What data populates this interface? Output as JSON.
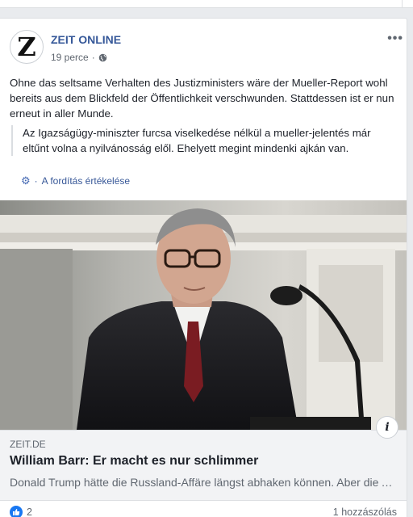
{
  "post": {
    "page_name": "ZEIT ONLINE",
    "avatar_letter": "Z",
    "timestamp": "19 perce",
    "more_label": "•••",
    "text": "Ohne das seltsame Verhalten des Justizministers wäre der Mueller-Report wohl bereits aus dem Blickfeld der Öffentlichkeit verschwunden. Stattdessen ist er nun erneut in aller Munde.",
    "translation": "Az Igazságügy-miniszter furcsa viselkedése nélkül a mueller-jelentés már eltűnt volna a nyilvánosság elől. Ehelyett megint mindenki ajkán van.",
    "rate_translation": "A fordítás értékelése"
  },
  "link": {
    "domain": "ZEIT.DE",
    "headline": "William Barr: Er macht es nur schlimmer",
    "description": "Donald Trump hätte die Russland-Affäre längst abhaken können. Aber die Art, wie sein Justizminister mit dem Bericht umgeht…",
    "info_label": "i"
  },
  "footer": {
    "like_count": "2",
    "comments": "1 hozzászólás"
  },
  "colors": {
    "link_blue": "#365899",
    "like_blue": "#1877f2",
    "muted": "#606770"
  },
  "icons": [
    "globe-icon",
    "gear-icon",
    "info-icon",
    "like-icon",
    "more-icon"
  ]
}
